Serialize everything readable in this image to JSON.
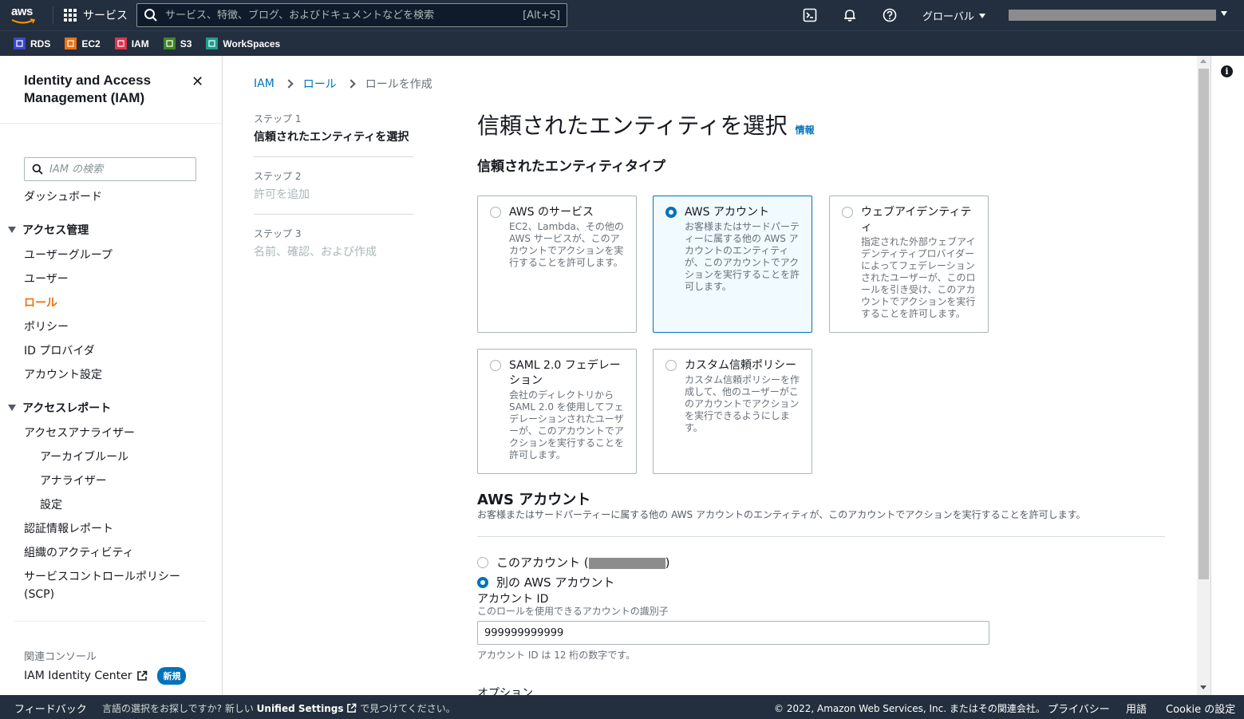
{
  "topnav": {
    "logo_text": "aws",
    "services_label": "サービス",
    "search_placeholder": "サービス、特徴、ブログ、およびドキュメントなどを検索",
    "search_shortcut": "[Alt+S]",
    "region_label": "グローバル"
  },
  "favorites": [
    {
      "label": "RDS",
      "color": "#3b48cc",
      "icon": "rds-icon"
    },
    {
      "label": "EC2",
      "color": "#ec7211",
      "icon": "ec2-icon"
    },
    {
      "label": "IAM",
      "color": "#dd344c",
      "icon": "iam-icon"
    },
    {
      "label": "S3",
      "color": "#3f8624",
      "icon": "s3-icon"
    },
    {
      "label": "WorkSpaces",
      "color": "#1b9e8e",
      "icon": "workspaces-icon"
    }
  ],
  "sidebar": {
    "title": "Identity and Access Management (IAM)",
    "search_placeholder": "IAM の検索",
    "dashboard": "ダッシュボード",
    "section_access_mgmt": "アクセス管理",
    "access_items": [
      "ユーザーグループ",
      "ユーザー",
      "ロール",
      "ポリシー",
      "ID プロバイダ",
      "アカウント設定"
    ],
    "active_item": "ロール",
    "section_access_report": "アクセスレポート",
    "analyzer": "アクセスアナライザー",
    "analyzer_sub": [
      "アーカイブルール",
      "アナライザー",
      "設定"
    ],
    "report_items": [
      "認証情報レポート",
      "組織のアクティビティ"
    ],
    "scp": "サービスコントロールポリシー (SCP)",
    "related_label": "関連コンソール",
    "identity_center": "IAM Identity Center",
    "new_badge": "新規"
  },
  "breadcrumb": [
    "IAM",
    "ロール",
    "ロールを作成"
  ],
  "steps": [
    {
      "label": "ステップ 1",
      "name": "信頼されたエンティティを選択"
    },
    {
      "label": "ステップ 2",
      "name": "許可を追加"
    },
    {
      "label": "ステップ 3",
      "name": "名前、確認、および作成"
    }
  ],
  "main": {
    "title": "信頼されたエンティティを選択",
    "info": "情報",
    "entity_type_heading": "信頼されたエンティティタイプ",
    "tiles": [
      {
        "title": "AWS のサービス",
        "desc": "EC2、Lambda、その他の AWS サービスが、このアカウントでアクションを実行することを許可します。"
      },
      {
        "title": "AWS アカウント",
        "desc": "お客様またはサードパーティーに属する他の AWS アカウントのエンティティが、このアカウントでアクションを実行することを許可します。"
      },
      {
        "title": "ウェブアイデンティティ",
        "desc": "指定された外部ウェブアイデンティティプロバイダーによってフェデレーションされたユーザーが、このロールを引き受け、このアカウントでアクションを実行することを許可します。"
      },
      {
        "title": "SAML 2.0 フェデレーション",
        "desc": "会社のディレクトリから SAML 2.0 を使用してフェデレーションされたユーザーが、このアカウントでアクションを実行することを許可します。"
      },
      {
        "title": "カスタム信頼ポリシー",
        "desc": "カスタム信頼ポリシーを作成して、他のユーザーがこのアカウントでアクションを実行できるようにします。"
      }
    ],
    "selected_tile": "AWS アカウント",
    "aws_account_heading": "AWS アカウント",
    "aws_account_desc": "お客様またはサードパーティーに属する他の AWS アカウントのエンティティが、このアカウントでアクションを実行することを許可します。",
    "option_this_account": "このアカウント (",
    "option_this_account_end": ")",
    "option_other_account": "別の AWS アカウント",
    "account_id_label": "アカウント ID",
    "account_id_desc": "このロールを使用できるアカウントの識別子",
    "account_id_value": "999999999999",
    "account_id_hint": "アカウント ID は 12 桁の数字です。",
    "options_heading": "オプション"
  },
  "footer": {
    "feedback": "フィードバック",
    "lang_prompt": "言語の選択をお探しですか? 新しい",
    "unified_settings": "Unified Settings",
    "lang_suffix": "で見つけてください。",
    "copyright": "© 2022, Amazon Web Services, Inc. またはその関連会社。",
    "privacy": "プライバシー",
    "terms": "用語",
    "cookie": "Cookie の設定"
  }
}
